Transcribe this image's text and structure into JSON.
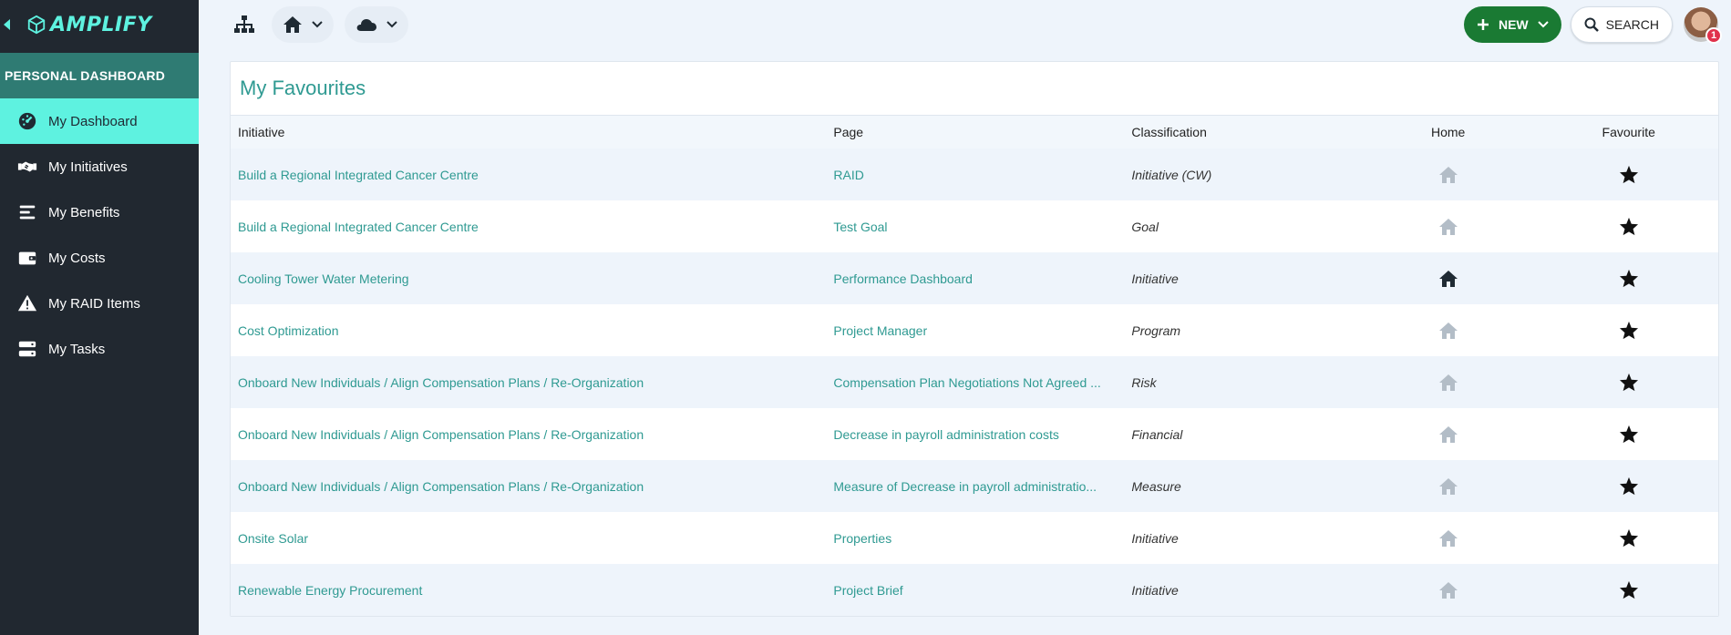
{
  "app": {
    "logo_text": "AMPLIFY",
    "accent": "#5ef2e0",
    "brand_teal": "#2f9a92"
  },
  "sidebar": {
    "section_header": "PERSONAL DASHBOARD",
    "items": [
      {
        "label": "My Dashboard",
        "icon": "dashboard-gauge-icon",
        "active": true
      },
      {
        "label": "My Initiatives",
        "icon": "handshake-icon",
        "active": false
      },
      {
        "label": "My Benefits",
        "icon": "list-bars-icon",
        "active": false
      },
      {
        "label": "My Costs",
        "icon": "wallet-icon",
        "active": false
      },
      {
        "label": "My RAID Items",
        "icon": "warning-triangle-icon",
        "active": false
      },
      {
        "label": "My Tasks",
        "icon": "tasks-icon",
        "active": false
      }
    ]
  },
  "topbar": {
    "new_label": "NEW",
    "search_label": "SEARCH",
    "notification_count": "1"
  },
  "main": {
    "title": "My Favourites",
    "columns": [
      "Initiative",
      "Page",
      "Classification",
      "Home",
      "Favourite"
    ],
    "rows": [
      {
        "initiative": "Build a Regional Integrated Cancer Centre",
        "page": "RAID",
        "classification": "Initiative (CW)",
        "home": false,
        "favourite": true
      },
      {
        "initiative": "Build a Regional Integrated Cancer Centre",
        "page": "Test Goal",
        "classification": "Goal",
        "home": false,
        "favourite": true
      },
      {
        "initiative": "Cooling Tower Water Metering",
        "page": "Performance Dashboard",
        "classification": "Initiative",
        "home": true,
        "favourite": true
      },
      {
        "initiative": "Cost Optimization",
        "page": "Project Manager",
        "classification": "Program",
        "home": false,
        "favourite": true
      },
      {
        "initiative": "Onboard New Individuals / Align Compensation Plans / Re-Organization",
        "page": "Compensation Plan Negotiations Not Agreed ...",
        "classification": "Risk",
        "home": false,
        "favourite": true
      },
      {
        "initiative": "Onboard New Individuals / Align Compensation Plans / Re-Organization",
        "page": "Decrease in payroll administration costs",
        "classification": "Financial",
        "home": false,
        "favourite": true
      },
      {
        "initiative": "Onboard New Individuals / Align Compensation Plans / Re-Organization",
        "page": "Measure of Decrease in payroll administratio...",
        "classification": "Measure",
        "home": false,
        "favourite": true
      },
      {
        "initiative": "Onsite Solar",
        "page": "Properties",
        "classification": "Initiative",
        "home": false,
        "favourite": true
      },
      {
        "initiative": "Renewable Energy Procurement",
        "page": "Project Brief",
        "classification": "Initiative",
        "home": false,
        "favourite": true
      }
    ]
  }
}
